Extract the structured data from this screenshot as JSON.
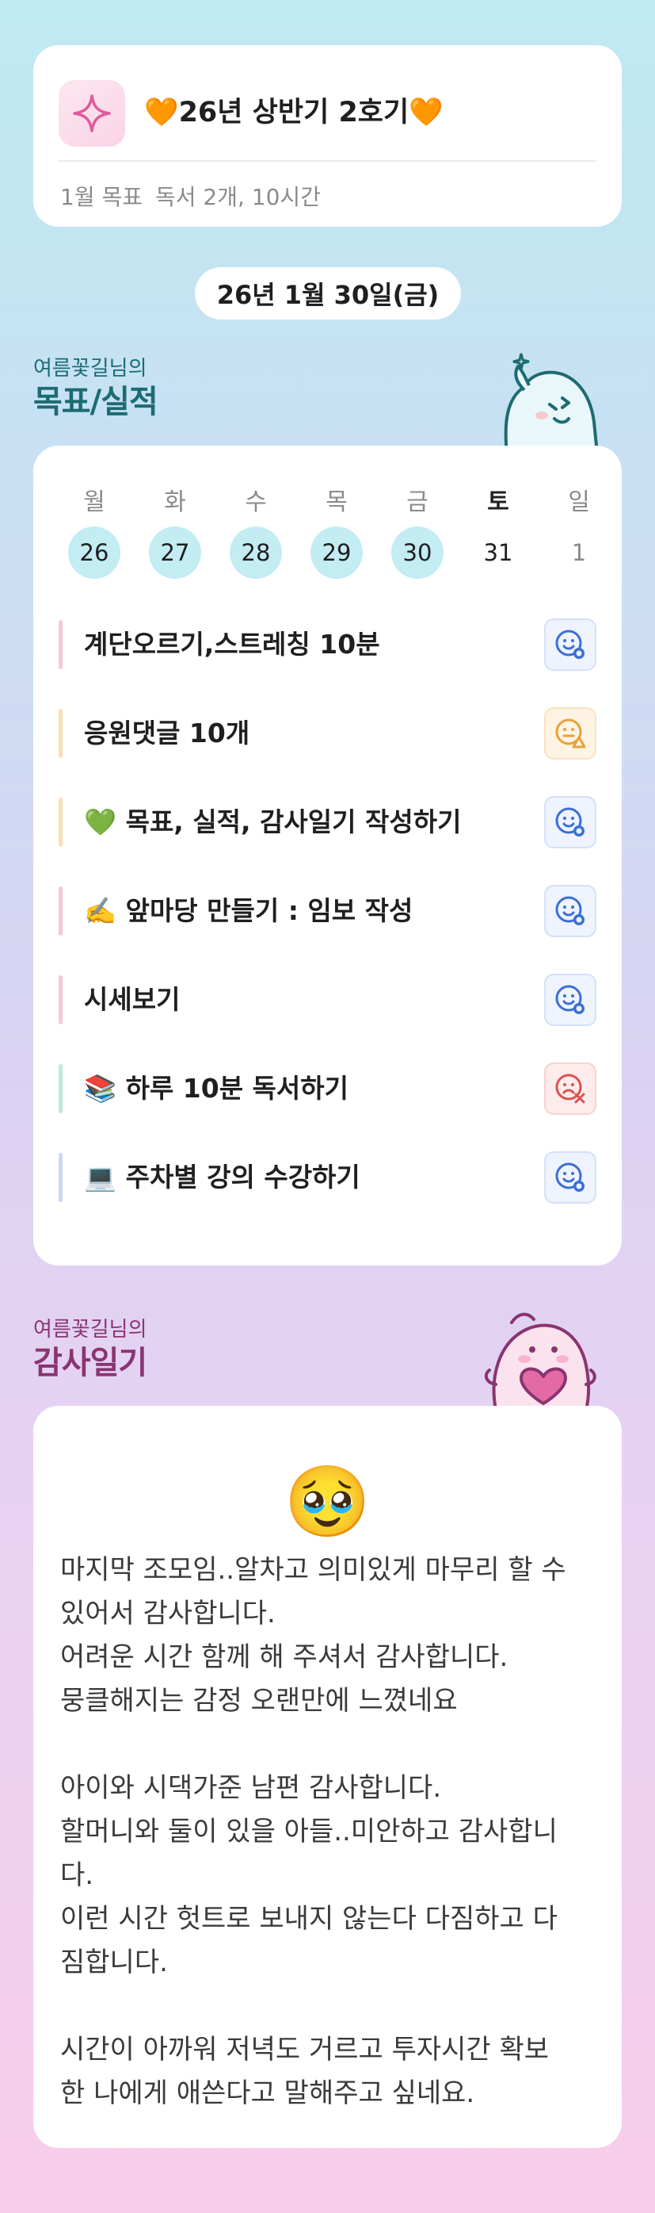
{
  "header": {
    "group_title": "🧡26년 상반기 2호기🧡",
    "goal_label": "1월 목표",
    "goal_value": "독서 2개, 10시간"
  },
  "date_pill": "26년 1월 30일(금)",
  "goals_section": {
    "owner_line": "여름꽃길님의",
    "title": "목표/실적"
  },
  "week": {
    "days": [
      {
        "name": "월",
        "date": "26",
        "state": "filled"
      },
      {
        "name": "화",
        "date": "27",
        "state": "filled"
      },
      {
        "name": "수",
        "date": "28",
        "state": "filled"
      },
      {
        "name": "목",
        "date": "29",
        "state": "filled"
      },
      {
        "name": "금",
        "date": "30",
        "state": "filled"
      },
      {
        "name": "토",
        "date": "31",
        "state": "today"
      },
      {
        "name": "일",
        "date": "1",
        "state": "next"
      }
    ]
  },
  "tasks": [
    {
      "label": "계단오르기,스트레칭 10분",
      "bar_color": "#f7c9d3",
      "status": "done"
    },
    {
      "label": "응원댓글 10개",
      "bar_color": "#fbe0b3",
      "status": "partial"
    },
    {
      "label": "💚 목표, 실적, 감사일기 작성하기",
      "bar_color": "#fbe0b3",
      "status": "done"
    },
    {
      "label": "✍️ 앞마당 만들기 : 임보 작성",
      "bar_color": "#f7c9d3",
      "status": "done"
    },
    {
      "label": "시세보기",
      "bar_color": "#f7c9d3",
      "status": "done"
    },
    {
      "label": "📚 하루 10분 독서하기",
      "bar_color": "#bde9d8",
      "status": "fail"
    },
    {
      "label": "💻 주차별 강의 수강하기",
      "bar_color": "#cad9f5",
      "status": "done"
    }
  ],
  "gratitude_section": {
    "owner_line": "여름꽃길님의",
    "title": "감사일기"
  },
  "gratitude": {
    "emoji": "🥹",
    "paragraphs": [
      "마지막 조모임..알차고 의미있게 마무리 할 수\n있어서 감사합니다.\n어려운 시간 함께 해 주셔서 감사합니다.\n뭉클해지는 감정 오랜만에 느꼈네요",
      "아이와 시댁가준 남편 감사합니다.\n할머니와 둘이 있을 아들..미안하고 감사합니\n다.\n이런 시간 헛트로 보내지 않는다 다짐하고 다\n짐합니다.",
      "시간이 아까워 저녁도 거르고 투자시간 확보\n한 나에게 애쓴다고 말해주고 싶네요."
    ]
  },
  "colors": {
    "goals_accent": "#1d6b73",
    "gratitude_accent": "#8a3472",
    "day_circle": "#c3ecf3",
    "status_done": "#3b6fd6",
    "status_partial": "#e8a23a",
    "status_fail": "#d9534f"
  }
}
